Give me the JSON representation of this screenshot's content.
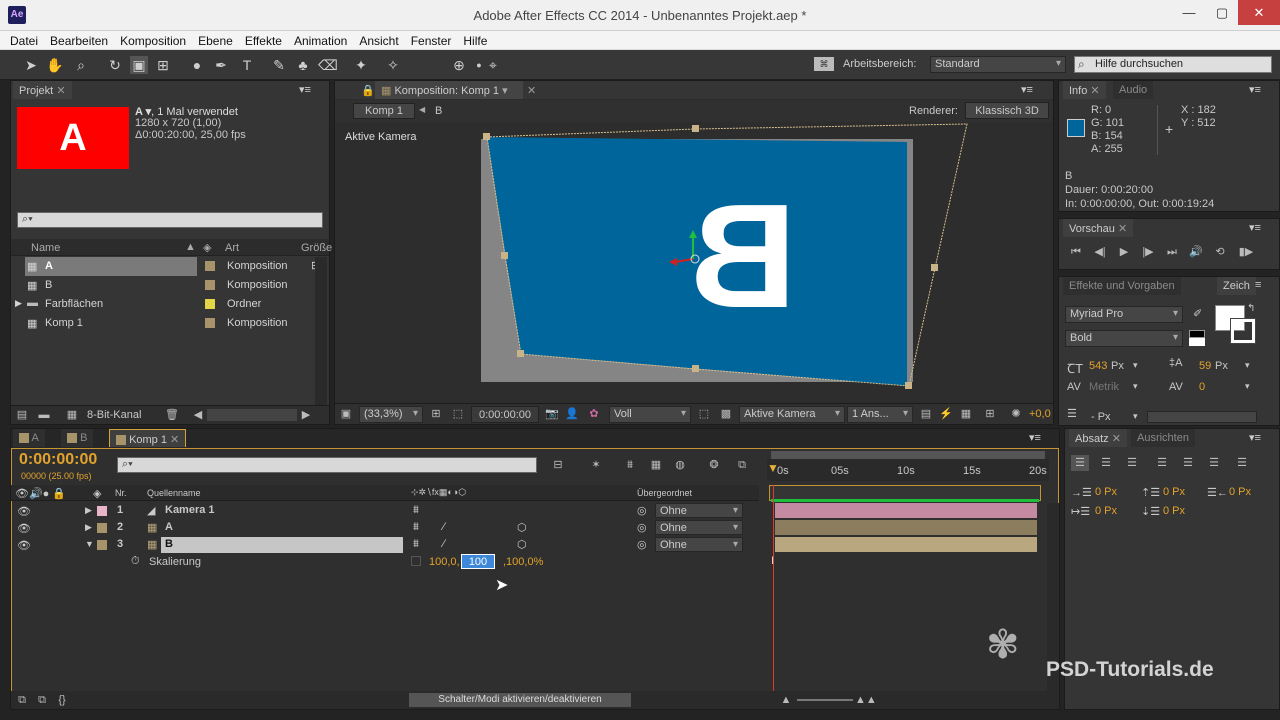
{
  "app": {
    "icon": "Ae",
    "title": "Adobe After Effects CC 2014 - Unbenanntes Projekt.aep *"
  },
  "menu": [
    "Datei",
    "Bearbeiten",
    "Komposition",
    "Ebene",
    "Effekte",
    "Animation",
    "Ansicht",
    "Fenster",
    "Hilfe"
  ],
  "toolbar": {
    "workspace_label": "Arbeitsbereich:",
    "workspace_value": "Standard",
    "help_placeholder": "Hilfe durchsuchen"
  },
  "project": {
    "tab": "Projekt",
    "thumb_letter": "A",
    "thumb_color": "#ff0000",
    "name": "A ▾",
    "uses": ", 1 Mal verwendet",
    "size": "1280 x 720 (1,00)",
    "duration": "Δ0:00:20:00, 25,00 fps",
    "col_name": "Name",
    "col_type": "Art",
    "col_size": "Größe",
    "items": [
      {
        "name": "A",
        "type": "Komposition",
        "color": "#a8946a"
      },
      {
        "name": "B",
        "type": "Komposition",
        "color": "#a8946a"
      },
      {
        "name": "Farbflächen",
        "type": "Ordner",
        "color": "#e3d64a"
      },
      {
        "name": "Komp 1",
        "type": "Komposition",
        "color": "#a8946a"
      }
    ],
    "bpc": "8-Bit-Kanal"
  },
  "comp": {
    "tab": "Komposition: Komp 1",
    "breadcrumb_current": "Komp 1",
    "breadcrumb_child": "B",
    "renderer_label": "Renderer:",
    "renderer_value": "Klassisch 3D",
    "view_label": "Aktive Kamera",
    "letter": "B",
    "layer_color": "#005f9b",
    "zoom": "(33,3%)",
    "time": "0:00:00:00",
    "resolution": "Voll",
    "camera": "Aktive Kamera",
    "views": "1 Ans...",
    "exposure": "+0,0"
  },
  "info": {
    "tab": "Info",
    "tab2": "Audio",
    "r": "R: 0",
    "g": "G: 101",
    "b": "B: 154",
    "a": "A: 255",
    "x": "X : 182",
    "y": "Y : 512",
    "swatch": "#00659a",
    "layer": "B",
    "dauer": "Dauer: 0:00:20:00",
    "inout": "In: 0:00:00:00, Out: 0:00:19:24"
  },
  "preview": {
    "tab": "Vorschau"
  },
  "effects": {
    "tab": "Effekte und Vorgaben",
    "tab2": "Zeich"
  },
  "character": {
    "font": "Myriad Pro",
    "style": "Bold",
    "size": "543",
    "size_unit": "Px",
    "leading": "59",
    "leading_unit": "Px",
    "kerning": "Metrik",
    "tracking": "0",
    "stroke": "- Px"
  },
  "paragraph": {
    "tab": "Absatz",
    "tab2": "Ausrichten",
    "v1": "0 Px",
    "v2": "0 Px",
    "v3": "0 Px",
    "v4": "0 Px",
    "v5": "0 Px"
  },
  "timeline": {
    "tabs": [
      "A",
      "B",
      "Komp 1"
    ],
    "timecode": "0:00:00:00",
    "frames": "00000 (25.00 fps)",
    "col_nr": "Nr.",
    "col_source": "Quellenname",
    "col_parent": "Übergeordnet",
    "ruler": [
      "0s",
      "05s",
      "10s",
      "15s",
      "20s"
    ],
    "layers": [
      {
        "nr": "1",
        "name": "Kamera 1",
        "parent": "Ohne",
        "bar": "#c48aa2",
        "label": "#e8b5c8"
      },
      {
        "nr": "2",
        "name": "A",
        "parent": "Ohne",
        "bar": "#8c7d5f",
        "label": "#a8946a"
      },
      {
        "nr": "3",
        "name": "B",
        "parent": "Ohne",
        "bar": "#8c7d5f",
        "label": "#a8946a"
      }
    ],
    "prop_name": "Skalierung",
    "prop_v1": "100,0,",
    "prop_edit": "100",
    "prop_v3": ",100,0%",
    "switch_toggle": "Schalter/Modi aktivieren/deaktivieren"
  },
  "watermark": "PSD-Tutorials.de"
}
